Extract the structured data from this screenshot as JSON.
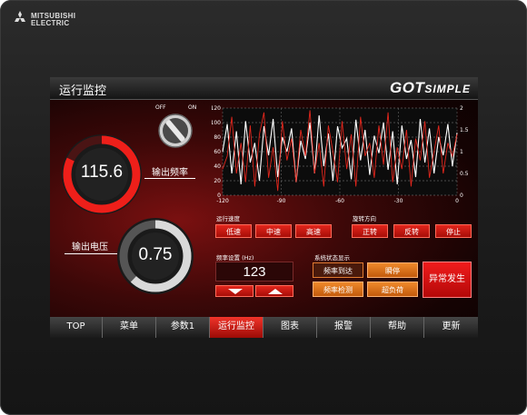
{
  "brand": {
    "line1": "MITSUBISHI",
    "line2": "ELECTRIC"
  },
  "screen": {
    "title": "运行监控",
    "product": {
      "main": "GOT",
      "sub": "SIMPLE"
    }
  },
  "switch": {
    "off_label": "OFF",
    "on_label": "ON"
  },
  "gauges": {
    "frequency": {
      "value": "115.6",
      "label": "输出频率",
      "fraction": 0.82
    },
    "voltage": {
      "value": "0.75",
      "label": "输出电压",
      "fraction": 0.62
    }
  },
  "chart_data": {
    "type": "line",
    "x_ticks": [
      "-120",
      "-90",
      "-60",
      "-30",
      "0"
    ],
    "y_left_ticks": [
      "120",
      "100",
      "80",
      "60",
      "40",
      "20",
      "0"
    ],
    "y_right_ticks": [
      "2",
      "1.5",
      "1",
      "0.5",
      "0"
    ],
    "xlim": [
      -120,
      0
    ],
    "ylim_left": [
      0,
      120
    ],
    "ylim_right": [
      0,
      2
    ],
    "grid": true,
    "series": [
      {
        "color": "#ffffff",
        "axis": "left",
        "values": [
          60,
          98,
          30,
          88,
          15,
          102,
          45,
          72,
          20,
          95,
          55,
          105,
          25,
          80,
          60,
          92,
          18,
          75,
          50,
          100,
          30,
          110,
          40,
          85,
          20,
          95,
          65,
          78,
          22,
          104,
          48,
          90,
          28,
          82,
          58,
          100,
          35,
          88,
          15,
          96,
          50,
          76,
          25,
          105,
          45,
          92,
          30,
          80,
          55,
          98,
          40,
          86
        ]
      },
      {
        "color": "#e3261c",
        "axis": "right",
        "values": [
          0.6,
          0.9,
          1.8,
          0.5,
          1.2,
          0.3,
          1.6,
          0.2,
          1.4,
          1.9,
          0.4,
          1.1,
          0.1,
          1.7,
          0.8,
          1.3,
          0.3,
          1.5,
          0.9,
          1.95,
          0.5,
          1.2,
          0.2,
          1.6,
          1.0,
          0.3,
          1.7,
          0.6,
          1.4,
          0.2,
          1.8,
          0.9,
          1.2,
          0.4,
          1.6,
          0.7,
          1.9,
          0.3,
          1.1,
          0.6,
          1.5,
          0.2,
          1.3,
          0.8,
          1.7,
          0.4,
          1.0,
          1.6,
          0.5,
          1.2,
          0.9,
          1.4
        ]
      }
    ]
  },
  "run_speed": {
    "title": "运行速度",
    "buttons": [
      "低速",
      "中速",
      "高速"
    ]
  },
  "rotation": {
    "title": "旋转方向",
    "buttons": [
      "正转",
      "反转",
      "停止"
    ]
  },
  "freq_set": {
    "title": "频率设置",
    "unit": "(Hz)",
    "value": "123"
  },
  "status": {
    "title": "系统状态显示",
    "lamps": [
      "频率到达",
      "瞬停",
      "频率检测",
      "超负荷"
    ]
  },
  "alarm": {
    "label": "异常发生"
  },
  "tabs": [
    "TOP",
    "菜单",
    "参数1",
    "运行监控",
    "图表",
    "报警",
    "帮助",
    "更新"
  ],
  "active_tab": 3
}
